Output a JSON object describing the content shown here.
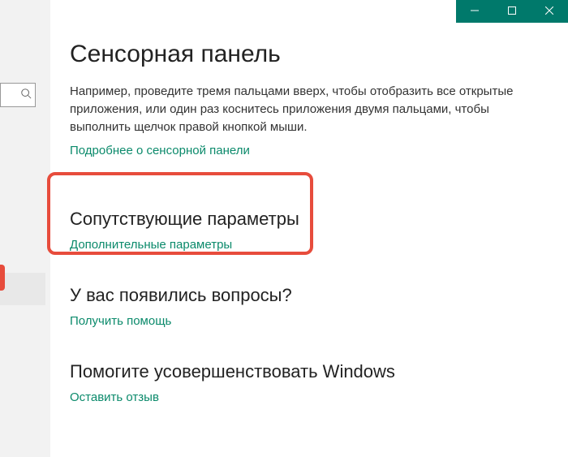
{
  "titlebar": {
    "minimize": "Minimize",
    "maximize": "Maximize",
    "close": "Close"
  },
  "sidebar": {
    "search_placeholder": ""
  },
  "page": {
    "title": "Сенсорная панель",
    "description": "Например, проведите тремя пальцами вверх, чтобы отобразить все открытые приложения, или один раз коснитесь приложения двумя пальцами, чтобы выполнить щелчок правой кнопкой мыши.",
    "learn_more": "Подробнее о сенсорной панели"
  },
  "related": {
    "heading": "Сопутствующие параметры",
    "link": "Дополнительные параметры"
  },
  "help": {
    "heading": "У вас появились вопросы?",
    "link": "Получить помощь"
  },
  "feedback": {
    "heading": "Помогите усовершенствовать Windows",
    "link": "Оставить отзыв"
  }
}
